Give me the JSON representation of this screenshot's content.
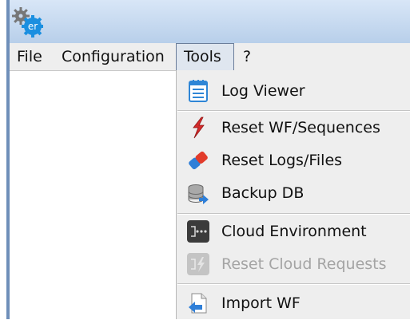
{
  "app": {
    "icon": "gear-er-icon",
    "icon_text": "er"
  },
  "menubar": {
    "items": [
      {
        "label": "File"
      },
      {
        "label": "Configuration"
      },
      {
        "label": "Tools"
      },
      {
        "label": "?"
      }
    ],
    "active": "Tools"
  },
  "tools_menu": {
    "items": [
      {
        "label": "Log Viewer",
        "icon": "log-viewer-icon",
        "enabled": true
      },
      {
        "label": "Reset WF/Sequences",
        "icon": "lightning-icon",
        "enabled": true
      },
      {
        "label": "Reset Logs/Files",
        "icon": "eraser-icon",
        "enabled": true
      },
      {
        "label": "Backup DB",
        "icon": "database-icon",
        "enabled": true
      },
      {
        "label": "Cloud Environment",
        "icon": "cloud-environment-icon",
        "enabled": true
      },
      {
        "label": "Reset Cloud Requests",
        "icon": "reset-cloud-requests-icon",
        "enabled": false
      },
      {
        "label": "Import WF",
        "icon": "import-icon",
        "enabled": true
      }
    ]
  }
}
